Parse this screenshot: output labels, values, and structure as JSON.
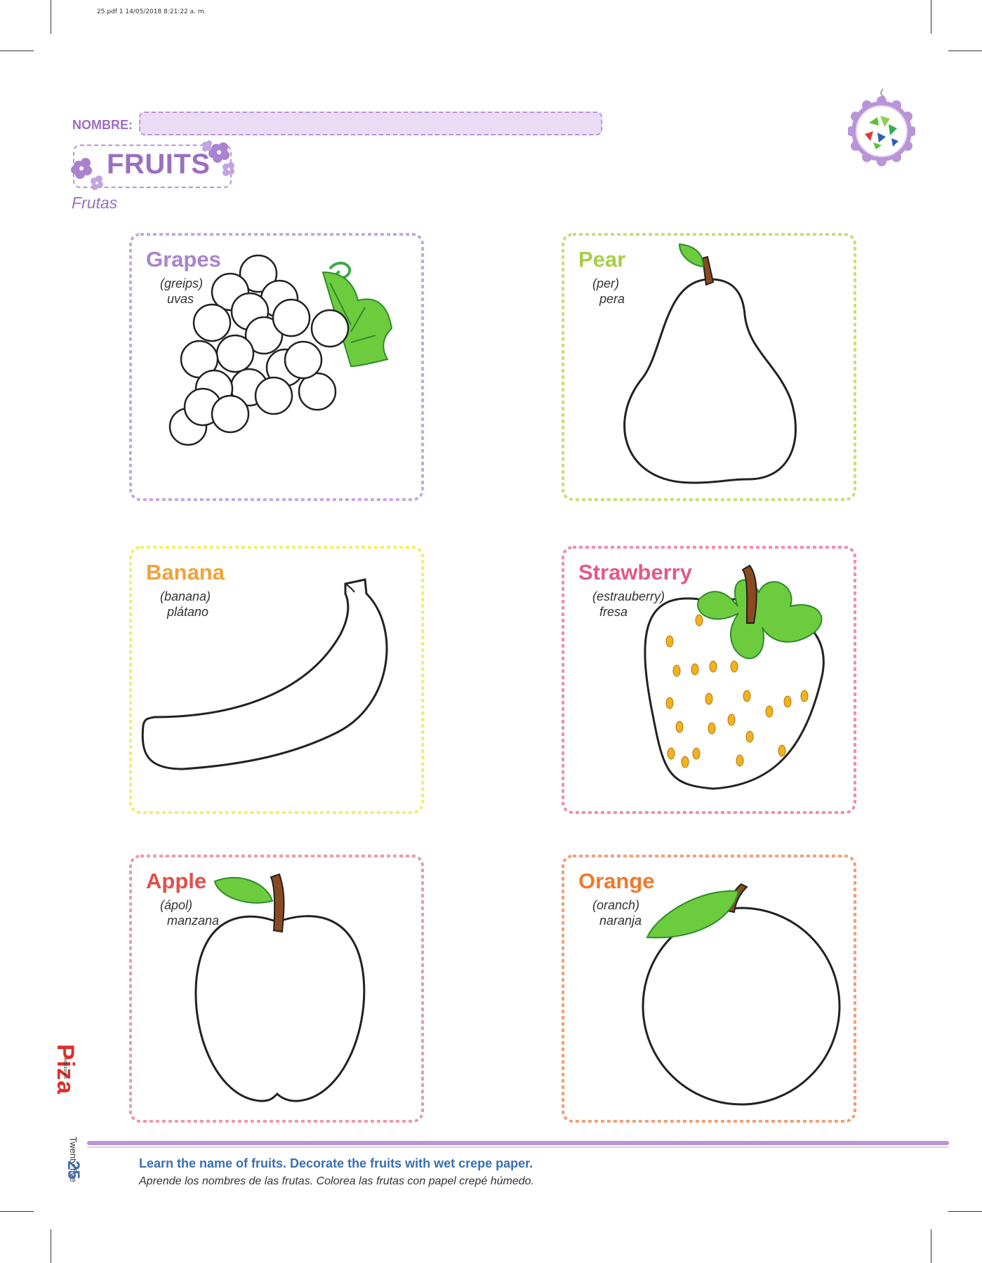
{
  "print_info": "25.pdf   1   14/05/2018   8:21:22 a. m.",
  "header": {
    "nombre_label": "NOMBRE:",
    "title": "FRUITS",
    "subtitle": "Frutas"
  },
  "cards": [
    {
      "name": "Grapes",
      "pron": "(greips)",
      "trans": "uvas",
      "color": "#a983cf"
    },
    {
      "name": "Pear",
      "pron": "(per)",
      "trans": "pera",
      "color": "#a6cf46"
    },
    {
      "name": "Banana",
      "pron": "(banana)",
      "trans": "plátano",
      "color": "#f0a33a"
    },
    {
      "name": "Strawberry",
      "pron": "(estrauberry)",
      "trans": "fresa",
      "color": "#e05a8a"
    },
    {
      "name": "Apple",
      "pron": "(ápol)",
      "trans": "manzana",
      "color": "#e0504c"
    },
    {
      "name": "Orange",
      "pron": "(oranch)",
      "trans": "naranja",
      "color": "#ee7a2e"
    }
  ],
  "frame_colors": [
    "#c8a8e0",
    "#c5e07a",
    "#f4ee6a",
    "#ee8fb0",
    "#ee9aa8",
    "#f1a07a"
  ],
  "footer": {
    "instruction_en": "Learn the name of fruits. Decorate the fruits with wet crepe paper.",
    "instruction_es": "Aprende los nombres de las frutas. Colorea las frutas con papel crepé húmedo.",
    "page_number": "25",
    "page_word": "Twenty five",
    "brand": "Piza",
    "brand_small": "ediciones"
  }
}
